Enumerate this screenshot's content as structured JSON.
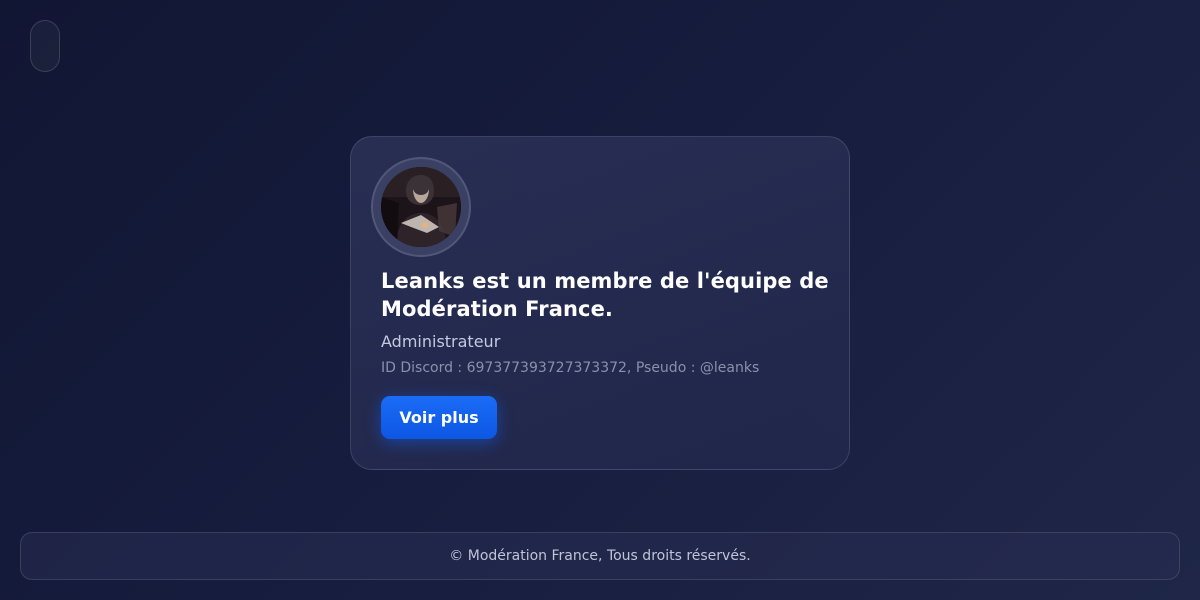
{
  "card": {
    "title": "Leanks est un membre de l'équipe de Modération France.",
    "role": "Administrateur",
    "discord_info": "ID Discord : 697377393727373372, Pseudo : @leanks",
    "button_label": "Voir plus"
  },
  "footer": {
    "text": "© Modération France, Tous droits réservés."
  },
  "colors": {
    "background": "#141a38",
    "accent": "#1463f3",
    "card": "#262c50"
  }
}
